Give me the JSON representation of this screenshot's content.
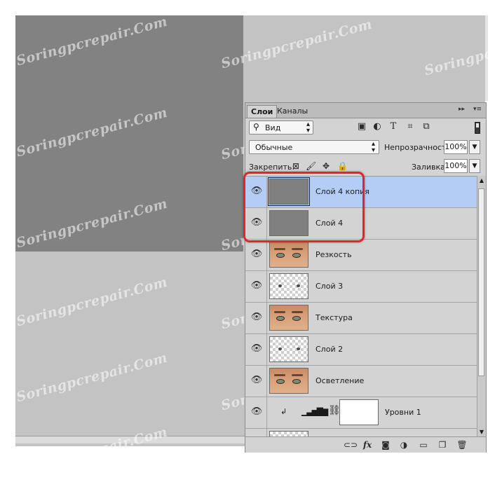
{
  "watermark_text": "Soringpcrepair.Com",
  "colors": {
    "highlight": "#e0262b",
    "selected_row": "#b4cdf5",
    "panel_bg": "#d3d3d3",
    "canvas_bg": "#c3c3c3",
    "doc_gray": "#828282"
  },
  "panel": {
    "tabs": [
      {
        "label": "Слои",
        "active": true
      },
      {
        "label": "Каналы",
        "active": false
      }
    ],
    "filter": {
      "label": "Вид",
      "icons": [
        "image-filter-icon",
        "adjustment-filter-icon",
        "type-filter-icon",
        "shape-filter-icon",
        "smart-object-filter-icon"
      ]
    },
    "blend_mode": "Обычные",
    "opacity_label": "Непрозрачность:",
    "opacity_value": "100%",
    "lock_label": "Закрепить:",
    "fill_label": "Заливка:",
    "fill_value": "100%"
  },
  "layers": [
    {
      "name": "Слой 4 копия",
      "thumb": "gray",
      "selected": true,
      "visible": true
    },
    {
      "name": "Слой 4",
      "thumb": "gray",
      "selected": false,
      "visible": true
    },
    {
      "name": "Резкость",
      "thumb": "eyes",
      "selected": false,
      "visible": true
    },
    {
      "name": "Слой 3",
      "thumb": "transparent",
      "selected": false,
      "visible": true
    },
    {
      "name": "Текстура",
      "thumb": "eyes",
      "selected": false,
      "visible": true
    },
    {
      "name": "Слой 2",
      "thumb": "transparent",
      "selected": false,
      "visible": true
    },
    {
      "name": "Осветление",
      "thumb": "eyes",
      "selected": false,
      "visible": true
    },
    {
      "name": "Уровни 1",
      "thumb": "adjustment-levels",
      "selected": false,
      "visible": true
    }
  ],
  "footer_icons": [
    "link-layers-icon",
    "fx-icon",
    "add-mask-icon",
    "new-adjustment-icon",
    "new-group-icon",
    "new-layer-icon",
    "delete-layer-icon"
  ],
  "footer_fx": "fx"
}
